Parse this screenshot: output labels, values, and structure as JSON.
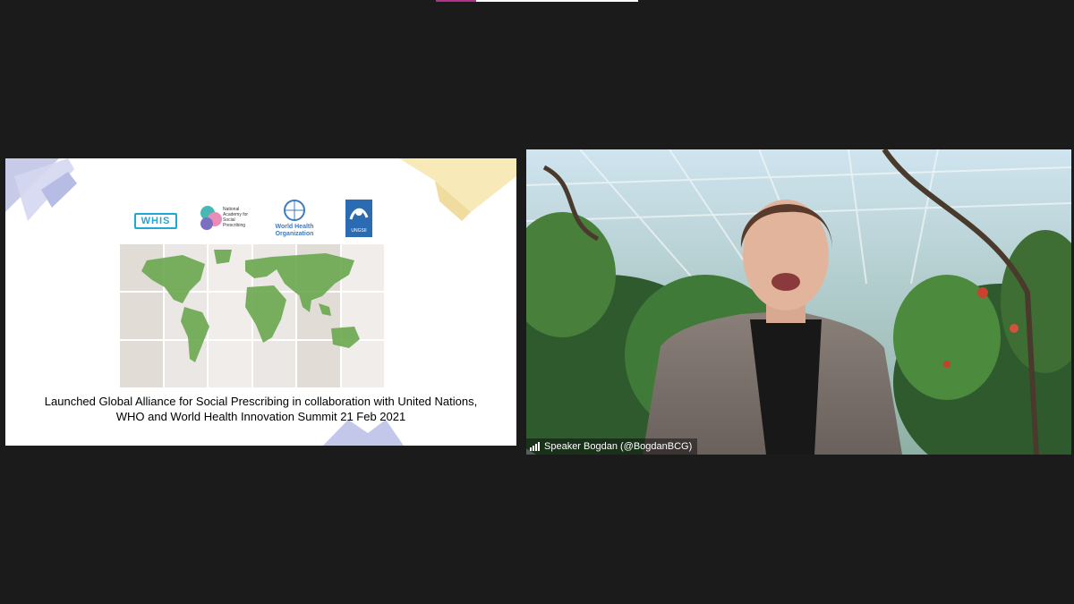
{
  "app": {
    "accent": "#b0338a"
  },
  "share": {
    "logos": {
      "whis": "WHIS",
      "nasp": "National Academy for Social Prescribing",
      "who": "World Health Organization",
      "ungsii": "UNGSII"
    },
    "caption_line1": "Launched Global Alliance for Social Prescribing in collaboration with United Nations,",
    "caption_line2": "WHO and World Health Innovation Summit 21 Feb 2021"
  },
  "video": {
    "speaker_label": "Speaker Bogdan (@BogdanBCG)",
    "icon": "signal-strength-icon"
  }
}
